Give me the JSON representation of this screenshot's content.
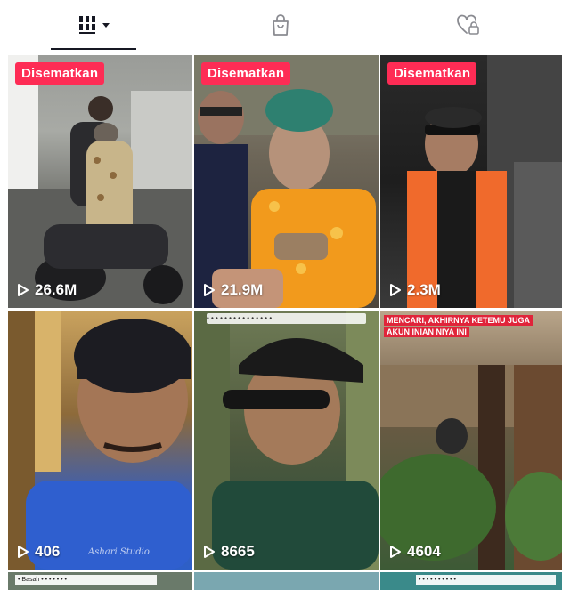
{
  "tabs": [
    {
      "name": "videos",
      "icon": "grid-icon",
      "active": true
    },
    {
      "name": "shop",
      "icon": "shopping-bag-icon",
      "active": false
    },
    {
      "name": "liked",
      "icon": "heart-lock-icon",
      "active": false
    }
  ],
  "videos": [
    {
      "pinned_label": "Disematkan",
      "views": "26.6M"
    },
    {
      "pinned_label": "Disematkan",
      "views": "21.9M"
    },
    {
      "pinned_label": "Disematkan",
      "views": "2.3M"
    },
    {
      "views": "406"
    },
    {
      "views": "8665",
      "caption": "• • • • • • • • • • • • • • •"
    },
    {
      "views": "4604",
      "caption": "MENCARI, AKHIRNYA KETEMU JUGA AKUN INIAN NIYA INI"
    }
  ],
  "bottom_row": [
    {
      "caption": "• Basah • • • • • • •"
    },
    {
      "caption": ""
    },
    {
      "caption": "• • • • • • • • • •"
    }
  ],
  "colors": {
    "accent": "#fe2c55",
    "text": "#161823",
    "background": "#ffffff"
  }
}
